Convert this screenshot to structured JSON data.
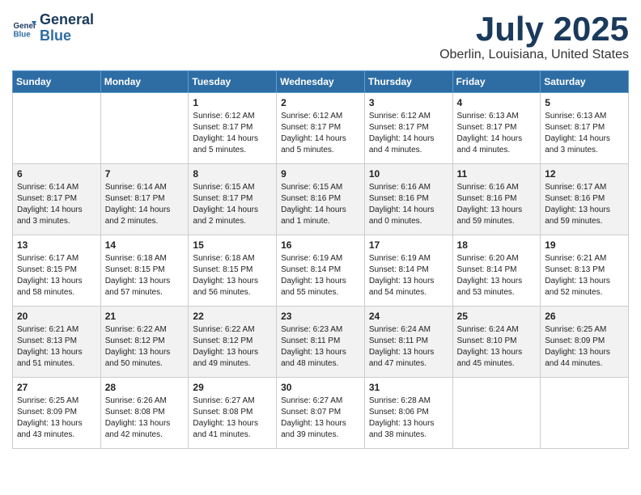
{
  "header": {
    "logo_line1": "General",
    "logo_line2": "Blue",
    "month_title": "July 2025",
    "location": "Oberlin, Louisiana, United States"
  },
  "weekdays": [
    "Sunday",
    "Monday",
    "Tuesday",
    "Wednesday",
    "Thursday",
    "Friday",
    "Saturday"
  ],
  "weeks": [
    [
      {
        "day": "",
        "detail": ""
      },
      {
        "day": "",
        "detail": ""
      },
      {
        "day": "1",
        "detail": "Sunrise: 6:12 AM\nSunset: 8:17 PM\nDaylight: 14 hours\nand 5 minutes."
      },
      {
        "day": "2",
        "detail": "Sunrise: 6:12 AM\nSunset: 8:17 PM\nDaylight: 14 hours\nand 5 minutes."
      },
      {
        "day": "3",
        "detail": "Sunrise: 6:12 AM\nSunset: 8:17 PM\nDaylight: 14 hours\nand 4 minutes."
      },
      {
        "day": "4",
        "detail": "Sunrise: 6:13 AM\nSunset: 8:17 PM\nDaylight: 14 hours\nand 4 minutes."
      },
      {
        "day": "5",
        "detail": "Sunrise: 6:13 AM\nSunset: 8:17 PM\nDaylight: 14 hours\nand 3 minutes."
      }
    ],
    [
      {
        "day": "6",
        "detail": "Sunrise: 6:14 AM\nSunset: 8:17 PM\nDaylight: 14 hours\nand 3 minutes."
      },
      {
        "day": "7",
        "detail": "Sunrise: 6:14 AM\nSunset: 8:17 PM\nDaylight: 14 hours\nand 2 minutes."
      },
      {
        "day": "8",
        "detail": "Sunrise: 6:15 AM\nSunset: 8:17 PM\nDaylight: 14 hours\nand 2 minutes."
      },
      {
        "day": "9",
        "detail": "Sunrise: 6:15 AM\nSunset: 8:16 PM\nDaylight: 14 hours\nand 1 minute."
      },
      {
        "day": "10",
        "detail": "Sunrise: 6:16 AM\nSunset: 8:16 PM\nDaylight: 14 hours\nand 0 minutes."
      },
      {
        "day": "11",
        "detail": "Sunrise: 6:16 AM\nSunset: 8:16 PM\nDaylight: 13 hours\nand 59 minutes."
      },
      {
        "day": "12",
        "detail": "Sunrise: 6:17 AM\nSunset: 8:16 PM\nDaylight: 13 hours\nand 59 minutes."
      }
    ],
    [
      {
        "day": "13",
        "detail": "Sunrise: 6:17 AM\nSunset: 8:15 PM\nDaylight: 13 hours\nand 58 minutes."
      },
      {
        "day": "14",
        "detail": "Sunrise: 6:18 AM\nSunset: 8:15 PM\nDaylight: 13 hours\nand 57 minutes."
      },
      {
        "day": "15",
        "detail": "Sunrise: 6:18 AM\nSunset: 8:15 PM\nDaylight: 13 hours\nand 56 minutes."
      },
      {
        "day": "16",
        "detail": "Sunrise: 6:19 AM\nSunset: 8:14 PM\nDaylight: 13 hours\nand 55 minutes."
      },
      {
        "day": "17",
        "detail": "Sunrise: 6:19 AM\nSunset: 8:14 PM\nDaylight: 13 hours\nand 54 minutes."
      },
      {
        "day": "18",
        "detail": "Sunrise: 6:20 AM\nSunset: 8:14 PM\nDaylight: 13 hours\nand 53 minutes."
      },
      {
        "day": "19",
        "detail": "Sunrise: 6:21 AM\nSunset: 8:13 PM\nDaylight: 13 hours\nand 52 minutes."
      }
    ],
    [
      {
        "day": "20",
        "detail": "Sunrise: 6:21 AM\nSunset: 8:13 PM\nDaylight: 13 hours\nand 51 minutes."
      },
      {
        "day": "21",
        "detail": "Sunrise: 6:22 AM\nSunset: 8:12 PM\nDaylight: 13 hours\nand 50 minutes."
      },
      {
        "day": "22",
        "detail": "Sunrise: 6:22 AM\nSunset: 8:12 PM\nDaylight: 13 hours\nand 49 minutes."
      },
      {
        "day": "23",
        "detail": "Sunrise: 6:23 AM\nSunset: 8:11 PM\nDaylight: 13 hours\nand 48 minutes."
      },
      {
        "day": "24",
        "detail": "Sunrise: 6:24 AM\nSunset: 8:11 PM\nDaylight: 13 hours\nand 47 minutes."
      },
      {
        "day": "25",
        "detail": "Sunrise: 6:24 AM\nSunset: 8:10 PM\nDaylight: 13 hours\nand 45 minutes."
      },
      {
        "day": "26",
        "detail": "Sunrise: 6:25 AM\nSunset: 8:09 PM\nDaylight: 13 hours\nand 44 minutes."
      }
    ],
    [
      {
        "day": "27",
        "detail": "Sunrise: 6:25 AM\nSunset: 8:09 PM\nDaylight: 13 hours\nand 43 minutes."
      },
      {
        "day": "28",
        "detail": "Sunrise: 6:26 AM\nSunset: 8:08 PM\nDaylight: 13 hours\nand 42 minutes."
      },
      {
        "day": "29",
        "detail": "Sunrise: 6:27 AM\nSunset: 8:08 PM\nDaylight: 13 hours\nand 41 minutes."
      },
      {
        "day": "30",
        "detail": "Sunrise: 6:27 AM\nSunset: 8:07 PM\nDaylight: 13 hours\nand 39 minutes."
      },
      {
        "day": "31",
        "detail": "Sunrise: 6:28 AM\nSunset: 8:06 PM\nDaylight: 13 hours\nand 38 minutes."
      },
      {
        "day": "",
        "detail": ""
      },
      {
        "day": "",
        "detail": ""
      }
    ]
  ]
}
